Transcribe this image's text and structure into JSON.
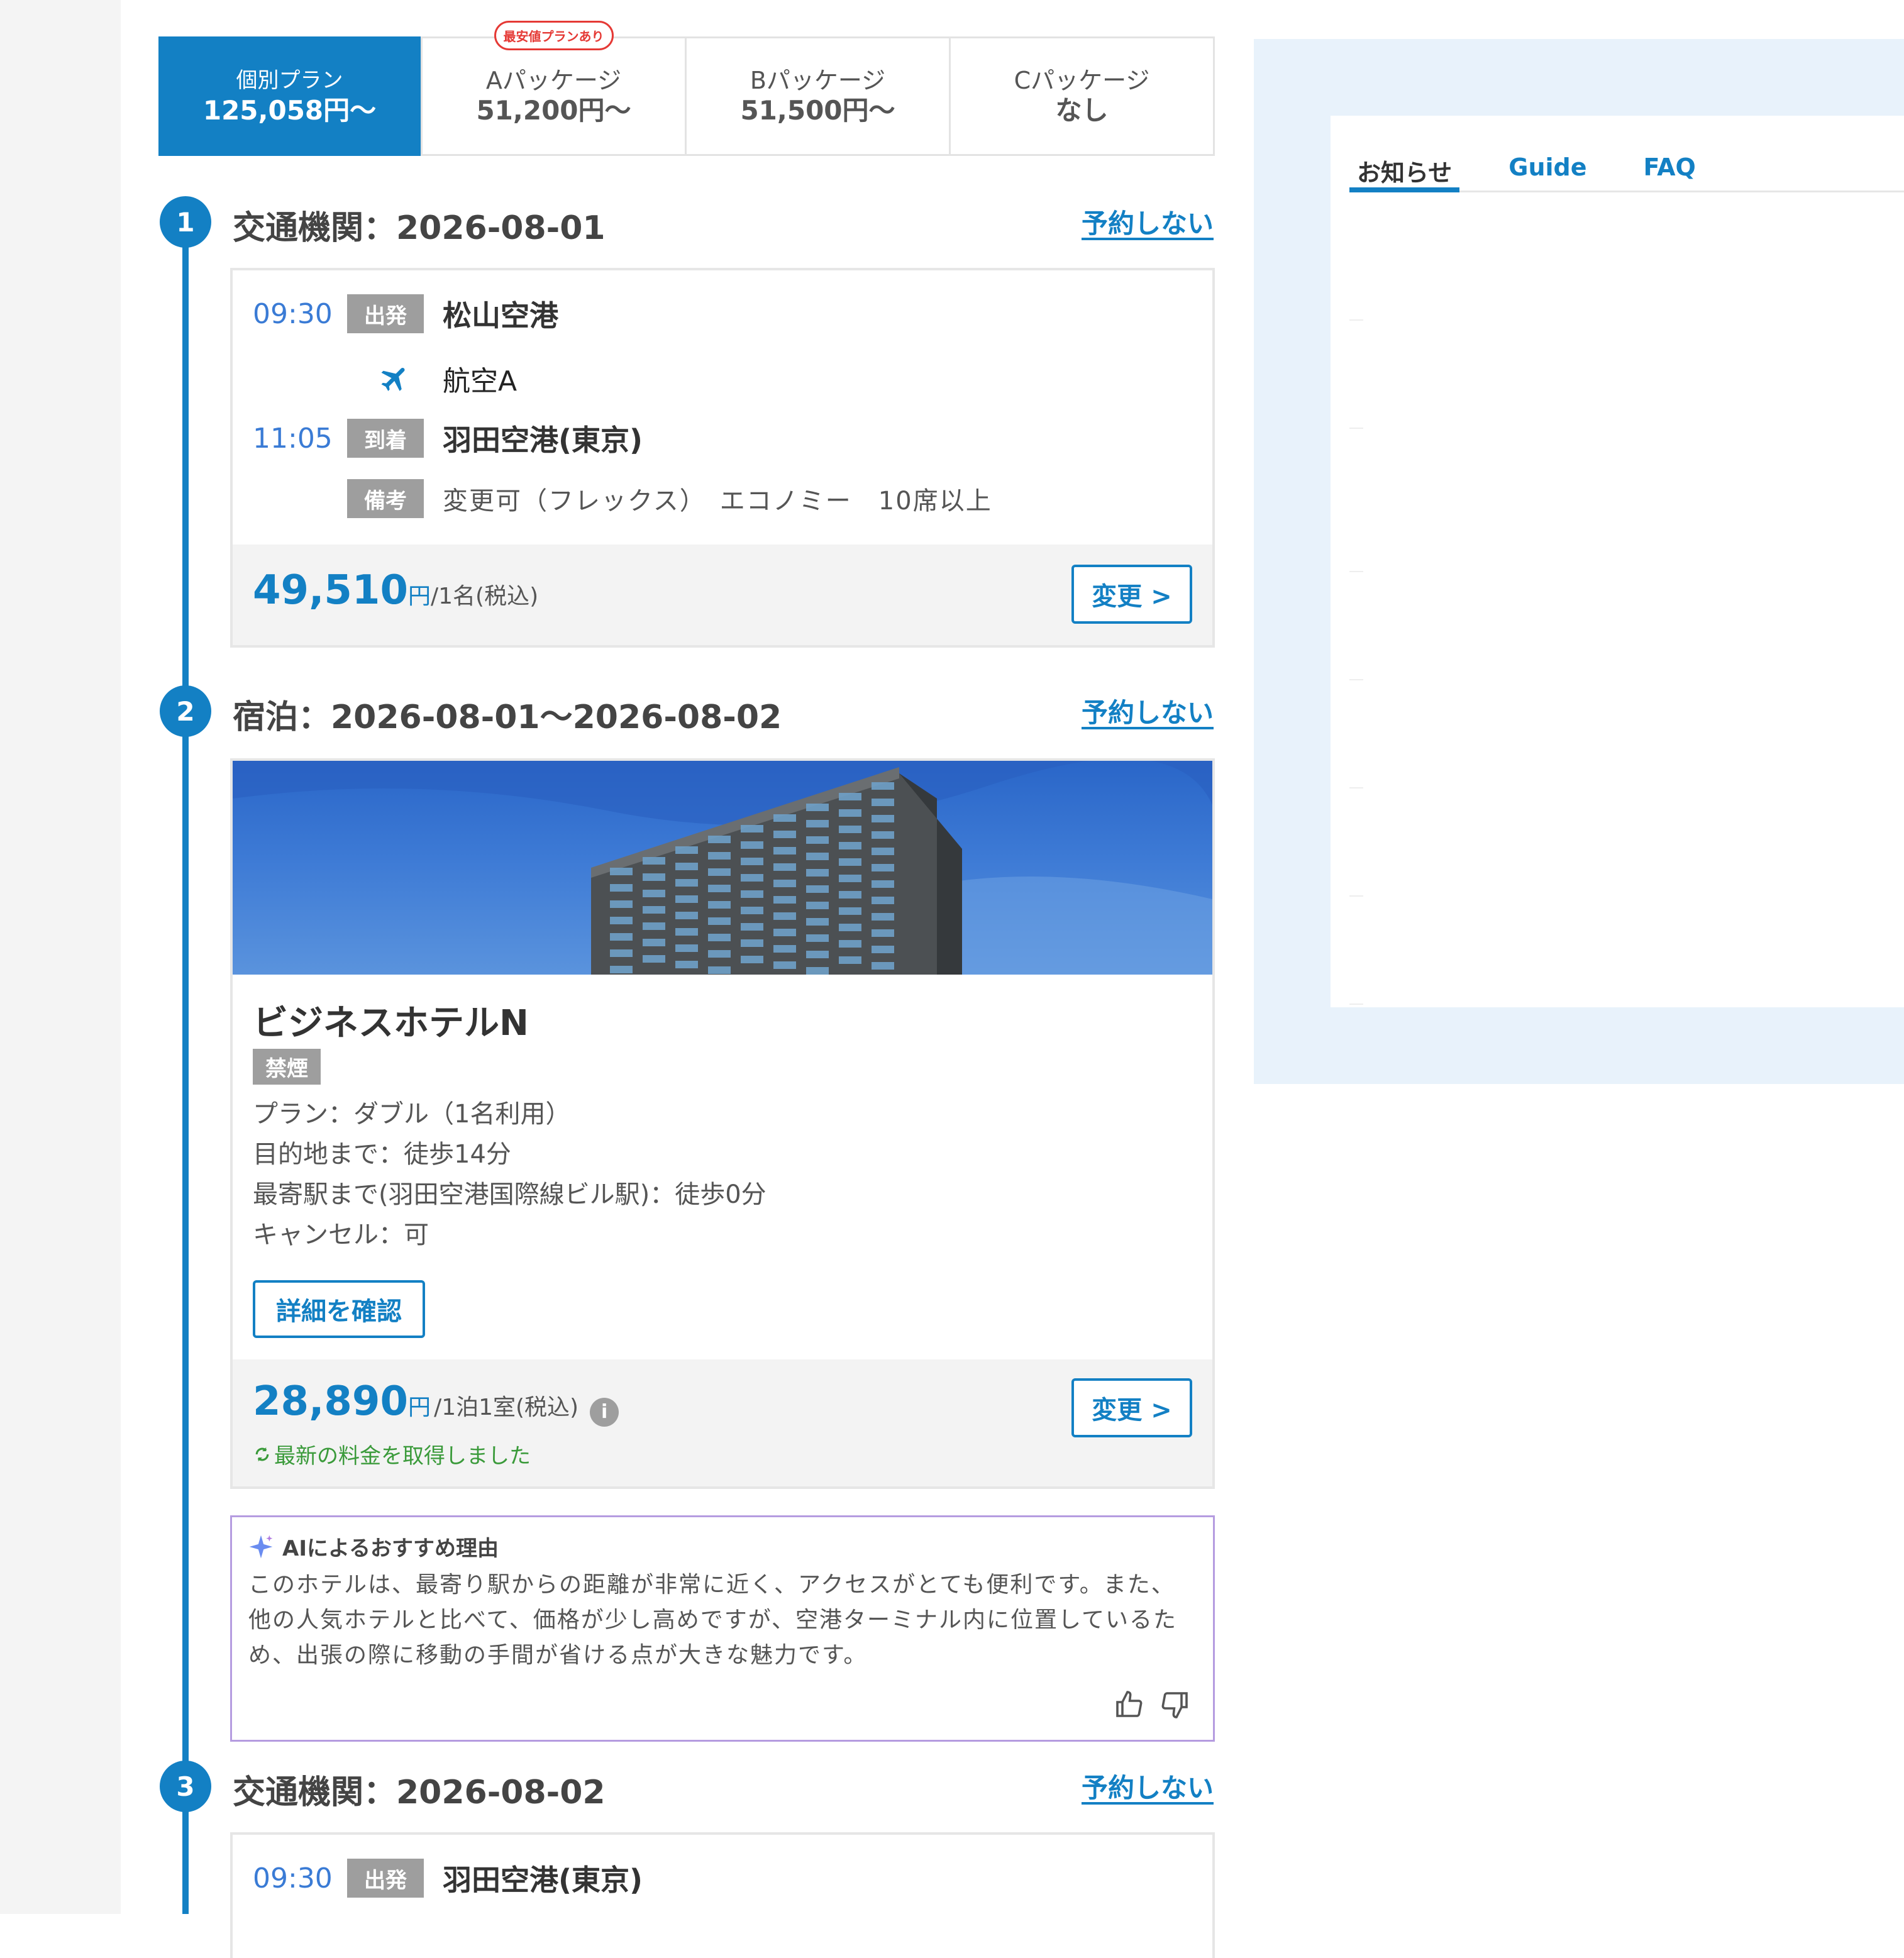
{
  "plan_tabs": [
    {
      "name": "個別プラン",
      "price": "125,058円〜",
      "active": true
    },
    {
      "name": "Aパッケージ",
      "price": "51,200円〜",
      "badge": "最安値プランあり"
    },
    {
      "name": "Bパッケージ",
      "price": "51,500円〜"
    },
    {
      "name": "Cパッケージ",
      "price": "なし"
    }
  ],
  "steps": [
    {
      "number": "1",
      "title": "交通機関：2026-08-01",
      "skip_label": "予約しない",
      "depart_time": "09:30",
      "depart_tag": "出発",
      "depart_place": "松山空港",
      "carrier": "航空A",
      "arrive_time": "11:05",
      "arrive_tag": "到着",
      "arrive_place": "羽田空港(東京)",
      "remark_tag": "備考",
      "remark": "変更可（フレックス）　エコノミー　10席以上",
      "price": "49,510",
      "price_unit": "円",
      "price_suffix": "/1名(税込)",
      "change_label": "変更 >"
    },
    {
      "number": "2",
      "title": "宿泊：2026-08-01〜2026-08-02",
      "skip_label": "予約しない",
      "hotel_name": "ビジネスホテルN",
      "badge": "禁煙",
      "info": [
        "プラン：ダブル（1名利用）",
        "目的地まで：徒歩14分",
        "最寄駅まで(羽田空港国際線ビル駅)：徒歩0分",
        "キャンセル：可"
      ],
      "detail_label": "詳細を確認",
      "price": "28,890",
      "price_unit": "円",
      "price_suffix": "/1泊1室(税込)",
      "updated": "最新の料金を取得しました",
      "change_label": "変更 >"
    },
    {
      "number": "3",
      "title": "交通機関：2026-08-02",
      "skip_label": "予約しない",
      "depart_time": "09:30",
      "depart_tag": "出発",
      "depart_place": "羽田空港(東京)"
    }
  ],
  "ai": {
    "title": "AIによるおすすめ理由",
    "text": "このホテルは、最寄り駅からの距離が非常に近く、アクセスがとても便利です。また、他の人気ホテルと比べて、価格が少し高めですが、空港ターミナル内に位置しているため、出張の際に移動の手間が省ける点が大きな魅力です。"
  },
  "news_tabs": [
    "お知らせ",
    "Guide",
    "FAQ"
  ],
  "colors": {
    "accent": "#1380c4",
    "tag_gray": "#9e9e9e",
    "panel_bg": "#e8f2fb",
    "ai_border": "#b59ce0",
    "success": "#3a9a3a"
  }
}
